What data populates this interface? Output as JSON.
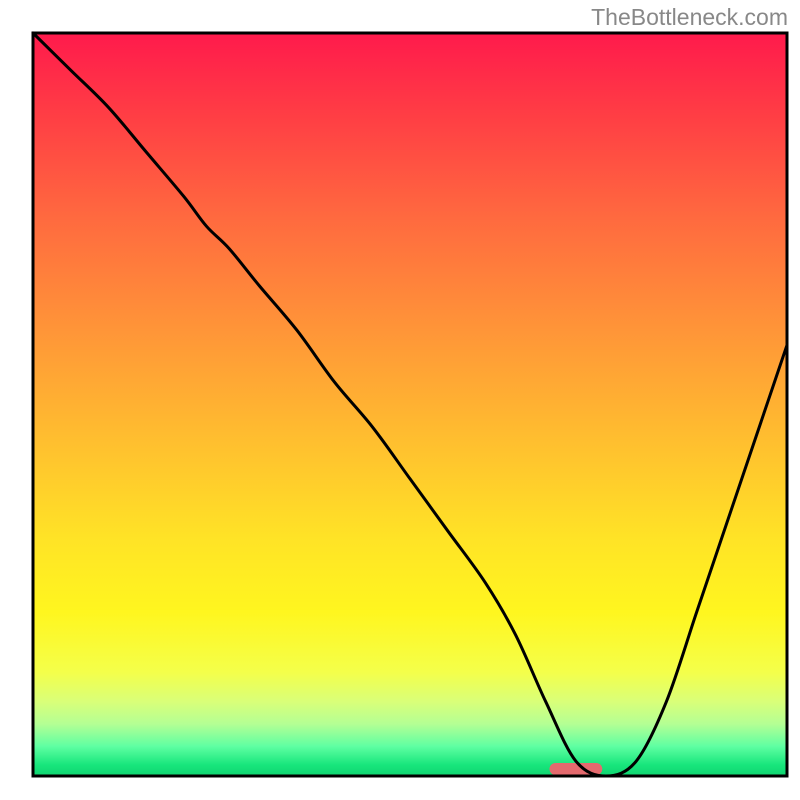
{
  "watermark": "TheBottleneck.com",
  "chart_data": {
    "type": "line",
    "title": "",
    "xlabel": "",
    "ylabel": "",
    "xlim": [
      0,
      100
    ],
    "ylim": [
      0,
      100
    ],
    "legend": false,
    "grid": false,
    "background": {
      "type": "vertical_gradient",
      "stops": [
        {
          "offset": 0.0,
          "color": "#ff1a4c"
        },
        {
          "offset": 0.1,
          "color": "#ff3a45"
        },
        {
          "offset": 0.25,
          "color": "#ff6a3f"
        },
        {
          "offset": 0.4,
          "color": "#ff9538"
        },
        {
          "offset": 0.55,
          "color": "#ffbf2f"
        },
        {
          "offset": 0.68,
          "color": "#ffe326"
        },
        {
          "offset": 0.78,
          "color": "#fff61f"
        },
        {
          "offset": 0.86,
          "color": "#f4ff4a"
        },
        {
          "offset": 0.9,
          "color": "#d9ff79"
        },
        {
          "offset": 0.93,
          "color": "#b4ff94"
        },
        {
          "offset": 0.96,
          "color": "#5fffa2"
        },
        {
          "offset": 0.985,
          "color": "#18e67c"
        },
        {
          "offset": 1.0,
          "color": "#0fd470"
        }
      ]
    },
    "marker": {
      "x": 72,
      "y": 0,
      "width": 7,
      "color": "#e46a6e"
    },
    "series": [
      {
        "name": "curve",
        "color": "#000000",
        "x": [
          0,
          5,
          10,
          15,
          20,
          23,
          26,
          30,
          35,
          40,
          45,
          50,
          55,
          60,
          64,
          68,
          72,
          76,
          80,
          84,
          88,
          92,
          96,
          100
        ],
        "y": [
          100,
          95,
          90,
          84,
          78,
          74,
          71,
          66,
          60,
          53,
          47,
          40,
          33,
          26,
          19,
          10,
          2,
          0,
          2,
          10,
          22,
          34,
          46,
          58
        ]
      }
    ]
  }
}
